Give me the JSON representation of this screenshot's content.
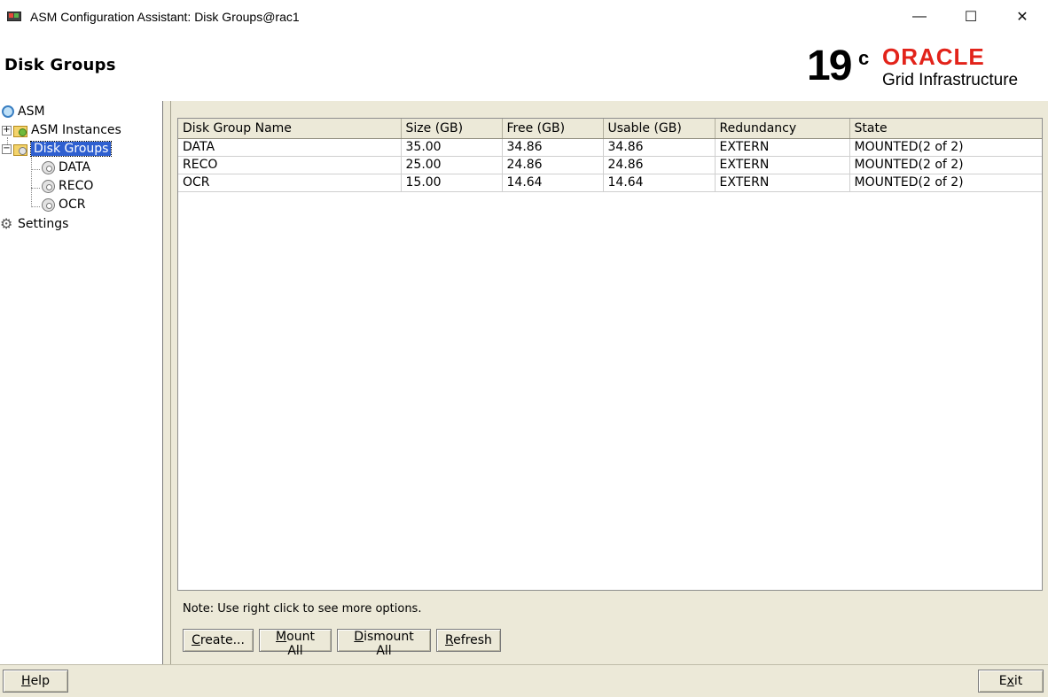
{
  "window": {
    "title": "ASM Configuration Assistant: Disk Groups@rac1",
    "minimize": "—",
    "maximize": "☐",
    "close": "✕"
  },
  "header": {
    "page_title": "Disk Groups",
    "logo_version": "19",
    "logo_version_suffix": "c",
    "logo_brand": "ORACLE",
    "logo_product": "Grid Infrastructure"
  },
  "tree": {
    "root": "ASM",
    "asm_instances": "ASM Instances",
    "disk_groups": "Disk Groups",
    "children": [
      "DATA",
      "RECO",
      "OCR"
    ],
    "settings": "Settings",
    "expand_symbol": "+",
    "collapse_symbol": "−"
  },
  "table": {
    "columns": [
      "Disk Group Name",
      "Size (GB)",
      "Free (GB)",
      "Usable (GB)",
      "Redundancy",
      "State"
    ],
    "rows": [
      [
        "DATA",
        "35.00",
        "34.86",
        "34.86",
        "EXTERN",
        "MOUNTED(2 of 2)"
      ],
      [
        "RECO",
        "25.00",
        "24.86",
        "24.86",
        "EXTERN",
        "MOUNTED(2 of 2)"
      ],
      [
        "OCR",
        "15.00",
        "14.64",
        "14.64",
        "EXTERN",
        "MOUNTED(2 of 2)"
      ]
    ]
  },
  "note": "Note: Use right click to see more options.",
  "buttons": {
    "create": {
      "mnemonic": "C",
      "rest": "reate..."
    },
    "mount_all": {
      "mnemonic": "M",
      "rest": "ount All"
    },
    "dismount_all": {
      "mnemonic": "D",
      "rest": "ismount All"
    },
    "refresh": {
      "mnemonic": "R",
      "rest": "efresh"
    },
    "help": {
      "mnemonic": "H",
      "rest": "elp"
    },
    "exit": {
      "pre": "E",
      "mnemonic": "x",
      "rest": "it"
    }
  },
  "icons": {
    "gear": "⚙"
  }
}
